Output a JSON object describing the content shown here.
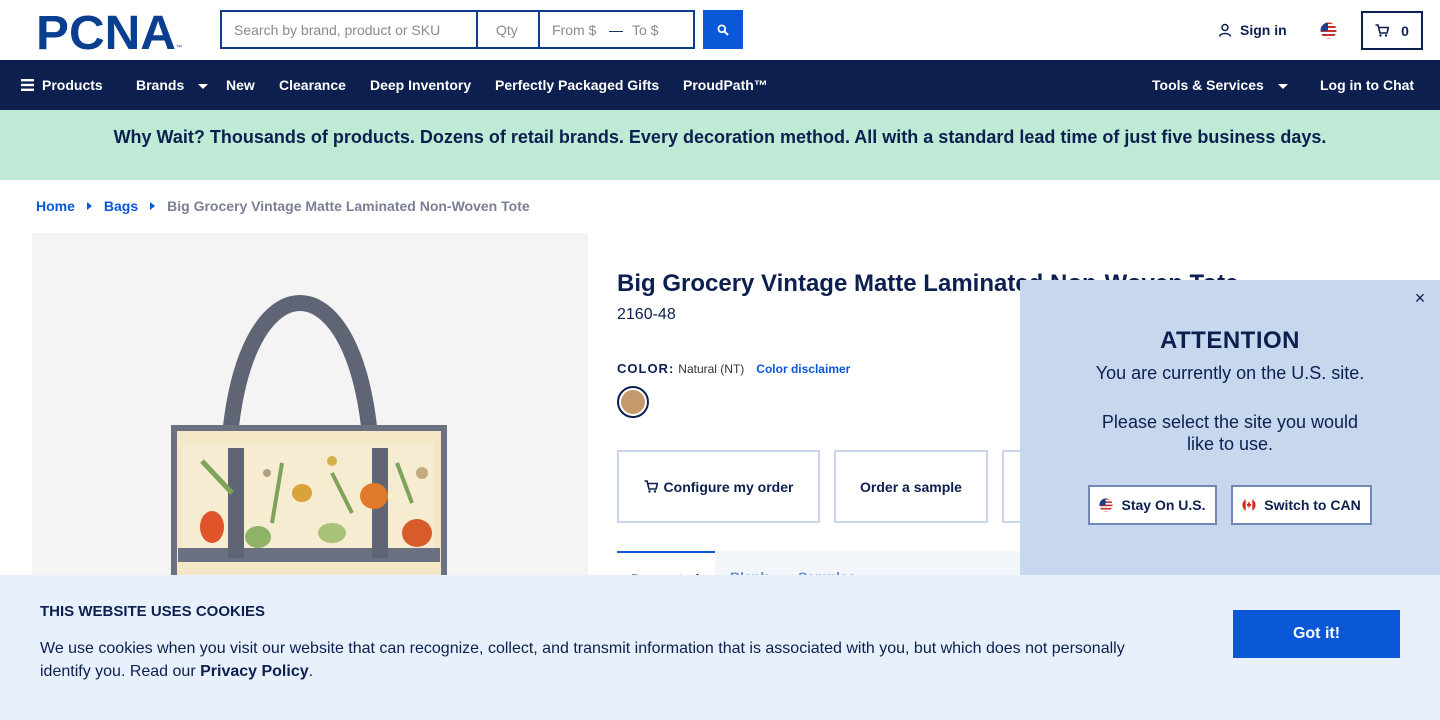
{
  "brand": {
    "logo_text": "PCNA",
    "accent": "#0a57d8",
    "navy": "#0c1f4f"
  },
  "header": {
    "search_placeholder": "Search by brand, product or SKU",
    "qty_placeholder": "Qty",
    "from_placeholder": "From $",
    "range_dash": "—",
    "to_placeholder": "To $",
    "search_icon": "search-icon",
    "signin_label": "Sign in",
    "country_flag": "us-flag-icon",
    "cart_count": "0"
  },
  "navbar": {
    "products": "Products",
    "brands": "Brands",
    "new": "New",
    "clearance": "Clearance",
    "deep_inventory": "Deep Inventory",
    "packaged_gifts": "Perfectly Packaged Gifts",
    "proudpath": "ProudPath™",
    "tools_services": "Tools & Services",
    "chat": "Log in to Chat"
  },
  "promo": {
    "text": "Why Wait? Thousands of products. Dozens of retail brands. Every decoration method. All with a standard lead time of just five business days."
  },
  "breadcrumb": {
    "home": "Home",
    "bags": "Bags",
    "current": "Big Grocery Vintage Matte Laminated Non-Woven Tote"
  },
  "product": {
    "title": "Big Grocery Vintage Matte Laminated Non-Woven Tote",
    "sku": "2160-48",
    "color_label": "COLOR:",
    "color_value": "Natural (NT)",
    "color_disclaimer": "Color disclaimer",
    "swatch_color": "#c49a6c",
    "configure_label": "Configure my order",
    "sample_label": "Order a sample",
    "tabs": [
      "Decorated",
      "Blank",
      "Samples"
    ]
  },
  "modal": {
    "close": "×",
    "title": "ATTENTION",
    "line1": "You are currently on the U.S. site.",
    "line2": "Please select the site you would",
    "line3": "like to use.",
    "stay_label": "Stay On U.S.",
    "switch_label": "Switch to CAN"
  },
  "cookie": {
    "title": "THIS WEBSITE USES COOKIES",
    "text": "We use cookies when you visit our website that can recognize, collect, and transmit information that is associated with you, but which does not personally identify you. Read our ",
    "link": "Privacy Policy",
    "end": ".",
    "button": "Got it!"
  }
}
